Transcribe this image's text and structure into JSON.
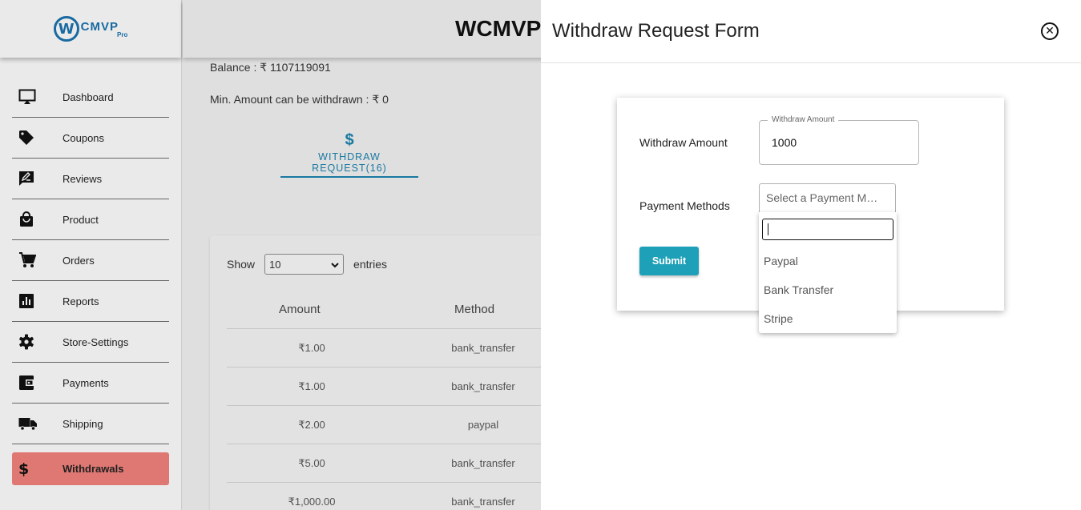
{
  "sidebar": {
    "logo": {
      "mark": "W",
      "text": "CMVP",
      "sub": "Pro"
    },
    "items": [
      {
        "label": "Dashboard",
        "icon": "monitor-icon"
      },
      {
        "label": "Coupons",
        "icon": "tag-icon"
      },
      {
        "label": "Reviews",
        "icon": "review-icon"
      },
      {
        "label": "Product",
        "icon": "shopping-bag-icon"
      },
      {
        "label": "Orders",
        "icon": "cart-icon"
      },
      {
        "label": "Reports",
        "icon": "bar-chart-icon"
      },
      {
        "label": "Store-Settings",
        "icon": "gear-icon"
      },
      {
        "label": "Payments",
        "icon": "wallet-icon"
      },
      {
        "label": "Shipping",
        "icon": "truck-icon"
      },
      {
        "label": "Withdrawals",
        "icon": "dollar-icon",
        "active": true
      }
    ],
    "active_color": "#e97d77"
  },
  "header": {
    "title": "WCMVP"
  },
  "main": {
    "balance": "Balance : ₹ 1107119091",
    "min_amount": "Min. Amount can be withdrawn : ₹ 0",
    "tab": {
      "icon": "$",
      "label": "WITHDRAW REQUEST(16)"
    },
    "table": {
      "show_label": "Show",
      "entries_value": "10",
      "entries_label": "entries",
      "columns": [
        "Amount",
        "Method"
      ],
      "rows": [
        {
          "amount": "₹1.00",
          "method": "bank_transfer"
        },
        {
          "amount": "₹1.00",
          "method": "bank_transfer"
        },
        {
          "amount": "₹2.00",
          "method": "paypal"
        },
        {
          "amount": "₹5.00",
          "method": "bank_transfer"
        },
        {
          "amount": "₹1,000.00",
          "method": "bank_transfer"
        }
      ]
    }
  },
  "drawer": {
    "title": "Withdraw Request Form",
    "close_icon": "close-circle-icon",
    "form": {
      "amount_label": "Withdraw Amount",
      "amount_legend": "Withdraw Amount",
      "amount_value": "1000",
      "payment_label": "Payment Methods",
      "payment_placeholder": "Select a Payment M…",
      "submit_label": "Submit",
      "options": [
        "Paypal",
        "Bank Transfer",
        "Stripe"
      ]
    },
    "accent": "#1fa0b9"
  }
}
